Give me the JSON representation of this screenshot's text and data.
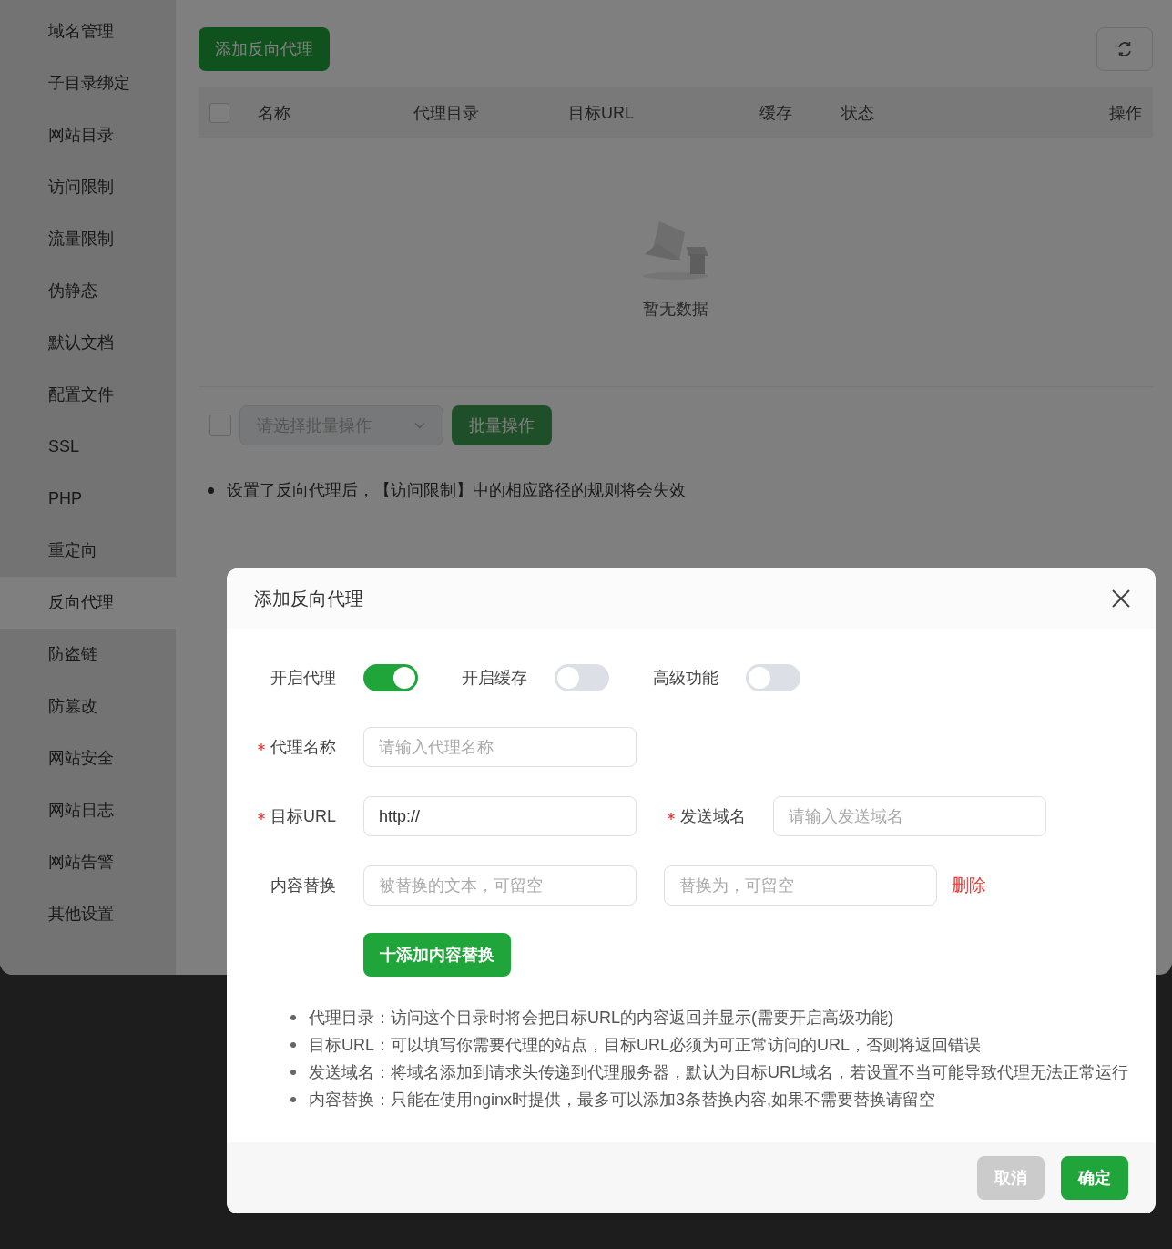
{
  "sidebar": {
    "items": [
      {
        "label": "域名管理",
        "selected": false
      },
      {
        "label": "子目录绑定",
        "selected": false
      },
      {
        "label": "网站目录",
        "selected": false
      },
      {
        "label": "访问限制",
        "selected": false
      },
      {
        "label": "流量限制",
        "selected": false
      },
      {
        "label": "伪静态",
        "selected": false
      },
      {
        "label": "默认文档",
        "selected": false
      },
      {
        "label": "配置文件",
        "selected": false
      },
      {
        "label": "SSL",
        "selected": false
      },
      {
        "label": "PHP",
        "selected": false
      },
      {
        "label": "重定向",
        "selected": false
      },
      {
        "label": "反向代理",
        "selected": true
      },
      {
        "label": "防盗链",
        "selected": false
      },
      {
        "label": "防篡改",
        "selected": false
      },
      {
        "label": "网站安全",
        "selected": false
      },
      {
        "label": "网站日志",
        "selected": false
      },
      {
        "label": "网站告警",
        "selected": false
      },
      {
        "label": "其他设置",
        "selected": false
      }
    ]
  },
  "toolbar": {
    "add_button": "添加反向代理"
  },
  "table": {
    "select_all_checked": false,
    "columns": [
      "名称",
      "代理目录",
      "目标URL",
      "缓存",
      "状态",
      "操作"
    ],
    "empty_text": "暂无数据"
  },
  "batch": {
    "checked": false,
    "select_placeholder": "请选择批量操作",
    "button": "批量操作"
  },
  "notes": [
    "设置了反向代理后，【访问限制】中的相应路径的规则将会失效"
  ],
  "dialog": {
    "title": "添加反向代理",
    "switches": [
      {
        "label": "开启代理",
        "on": true
      },
      {
        "label": "开启缓存",
        "on": false
      },
      {
        "label": "高级功能",
        "on": false
      }
    ],
    "proxy_name": {
      "label": "代理名称",
      "required": true,
      "placeholder": "请输入代理名称"
    },
    "target_url": {
      "label": "目标URL",
      "required": true,
      "value": "http://"
    },
    "send_domain": {
      "label": "发送域名",
      "required": true,
      "placeholder": "请输入发送域名"
    },
    "content_replace": {
      "label": "内容替换",
      "required": false,
      "placeholders": [
        "被替换的文本，可留空",
        "替换为，可留空"
      ],
      "delete_link": "删除"
    },
    "add_replace_button": "十添加内容替换",
    "notes": [
      "代理目录：访问这个目录时将会把目标URL的内容返回并显示(需要开启高级功能)",
      "目标URL：可以填写你需要代理的站点，目标URL必须为可正常访问的URL，否则将返回错误",
      "发送域名：将域名添加到请求头传递到代理服务器，默认为目标URL域名，若设置不当可能导致代理无法正常运行",
      "内容替换：只能在使用nginx时提供，最多可以添加3条替换内容,如果不需要替换请留空"
    ],
    "buttons": [
      {
        "label": "取消",
        "kind": "secondary"
      },
      {
        "label": "确定",
        "kind": "primary"
      }
    ]
  }
}
